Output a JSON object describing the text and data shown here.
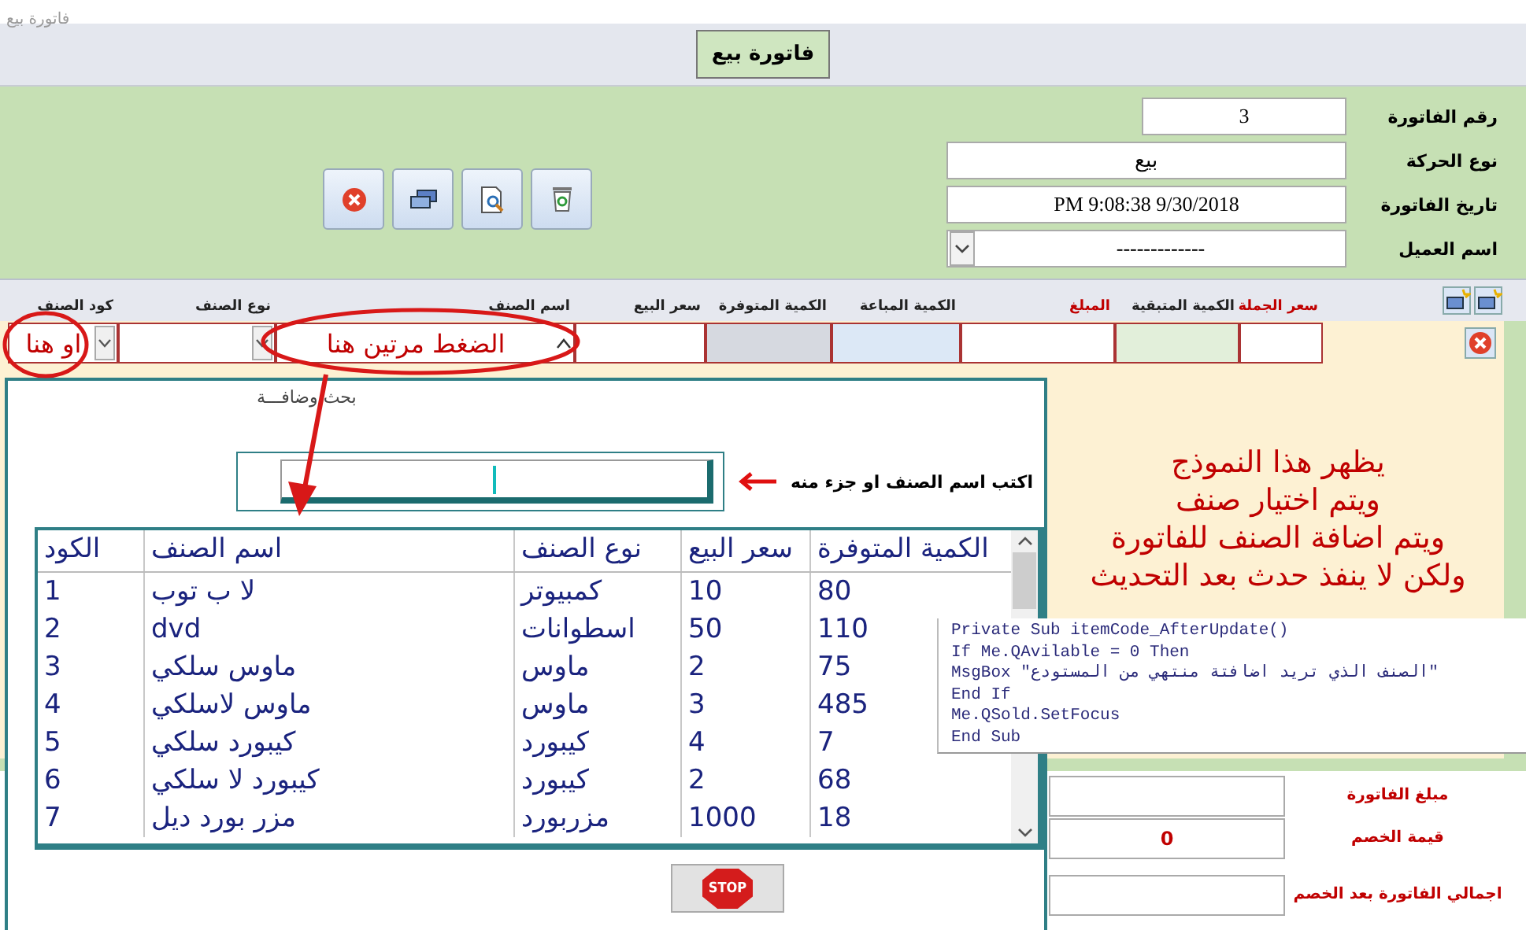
{
  "window": {
    "title": "فاتورة بيع"
  },
  "header": {
    "title_button": "فاتورة بيع"
  },
  "invoice_fields": [
    {
      "label": "رقم الفاتورة",
      "value": "3",
      "kind": "short"
    },
    {
      "label": "نوع الحركة",
      "value": "بيع",
      "kind": "text"
    },
    {
      "label": "تاريخ الفاتورة",
      "value": "9/30/2018 9:08:38 PM",
      "kind": "text"
    },
    {
      "label": "اسم العميل",
      "value": "-------------",
      "kind": "combo"
    }
  ],
  "toolbar": [
    {
      "kind": "close"
    },
    {
      "kind": "save"
    },
    {
      "kind": "preview"
    },
    {
      "kind": "recycle"
    }
  ],
  "subform": {
    "columns": [
      {
        "label": "سعر الجملة",
        "emphasis": true,
        "kind": "text",
        "color": "#ffffff"
      },
      {
        "label": "الكمية المتبقية",
        "emphasis": false,
        "kind": "text",
        "color": "#e2efda"
      },
      {
        "label": "المبلغ",
        "emphasis": true,
        "kind": "text",
        "color": "#ffffff"
      },
      {
        "label": "الكمية المباعة",
        "emphasis": false,
        "kind": "text",
        "color": "#dce8f6"
      },
      {
        "label": "الكمية المتوفرة",
        "emphasis": false,
        "kind": "text",
        "color": "#d6d9e0"
      },
      {
        "label": "سعر البيع",
        "emphasis": false,
        "kind": "text",
        "color": "#ffffff"
      },
      {
        "label": "اسم الصنف",
        "emphasis": false,
        "kind": "caret",
        "color": "#ffffff",
        "value": "الضغط مرتين هنا"
      },
      {
        "label": "نوع الصنف",
        "emphasis": false,
        "kind": "combo",
        "color": "#ffffff"
      },
      {
        "label": "كود الصنف",
        "emphasis": false,
        "kind": "combo",
        "color": "#ffffff",
        "value": "او هنا"
      }
    ]
  },
  "note": {
    "lines": [
      "يظهر هذا النموذج",
      "ويتم اختيار صنف",
      "ويتم اضافة الصنف للفاتورة",
      "ولكن لا ينفذ حدث بعد التحديث"
    ]
  },
  "popup": {
    "title": "بحث وضافـــة",
    "hint": "اكتب اسم الصنف او جزء منه",
    "list": {
      "columns": [
        "الكمية المتوفرة",
        "سعر البيع",
        "نوع الصنف",
        "اسم الصنف",
        "الكود"
      ],
      "rows": [
        [
          "80",
          "10",
          "كمبيوتر",
          "لا ب توب",
          "1"
        ],
        [
          "110",
          "50",
          "اسطوانات",
          "dvd",
          "2"
        ],
        [
          "75",
          "2",
          "ماوس",
          "ماوس  سلكي",
          "3"
        ],
        [
          "485",
          "3",
          "ماوس",
          "ماوس لاسلكي",
          "4"
        ],
        [
          "7",
          "4",
          "كيبورد",
          "كيبورد سلكي",
          "5"
        ],
        [
          "68",
          "2",
          "كيبورد",
          "كيبورد لا سلكي",
          "6"
        ],
        [
          "18",
          "1000",
          "مزربورد",
          "مزر بورد ديل",
          "7"
        ]
      ]
    },
    "stop_label": "STOP"
  },
  "code_snippet": {
    "lines": [
      "Private Sub itemCode_AfterUpdate()",
      "If Me.QAvilable = 0 Then",
      "MsgBox \"الصنف الذي تريد اضافتة منتهي من المستودع\"",
      "End If",
      "Me.QSold.SetFocus",
      "End Sub"
    ]
  },
  "totals": [
    {
      "label": "مبلغ الفاتورة"
    },
    {
      "label": "قيمة الخصم",
      "value": "0"
    },
    {
      "label": "اجمالي الفاتورة بعد الخصم"
    }
  ]
}
